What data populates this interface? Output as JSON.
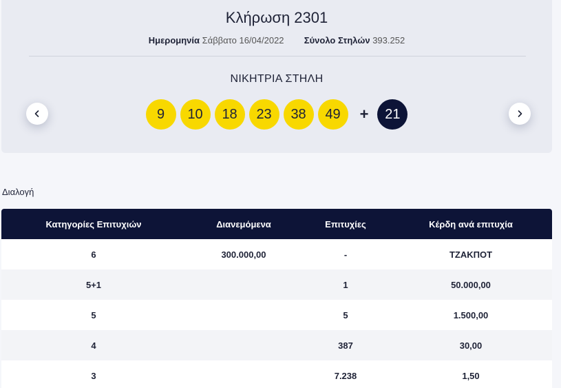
{
  "draw": {
    "title": "Κλήρωση 2301",
    "date_label": "Ημερομηνία",
    "date_value": "Σάββατο 16/04/2022",
    "columns_label": "Σύνολο Στηλών",
    "columns_value": "393.252",
    "winning_label": "ΝΙΚΗΤΡΙΑ ΣΤΗΛΗ",
    "numbers": [
      "9",
      "10",
      "18",
      "23",
      "38",
      "49"
    ],
    "plus": "+",
    "bonus": "21",
    "colors": {
      "ball": "#f8d800",
      "bonus": "#0d1437"
    }
  },
  "nav": {
    "prev_icon": "chevron-left-icon",
    "next_icon": "chevron-right-icon"
  },
  "section_label": "Διαλογή",
  "table": {
    "headers": [
      "Κατηγορίες Επιτυχιών",
      "Διανεμόμενα",
      "Επιτυχίες",
      "Κέρδη ανά επιτυχία"
    ],
    "rows": [
      [
        "6",
        "300.000,00",
        "-",
        "ΤΖΑΚΠΟΤ"
      ],
      [
        "5+1",
        "",
        "1",
        "50.000,00"
      ],
      [
        "5",
        "",
        "5",
        "1.500,00"
      ],
      [
        "4",
        "",
        "387",
        "30,00"
      ],
      [
        "3",
        "",
        "7.238",
        "1,50"
      ]
    ],
    "header_color": "#0d1437"
  }
}
